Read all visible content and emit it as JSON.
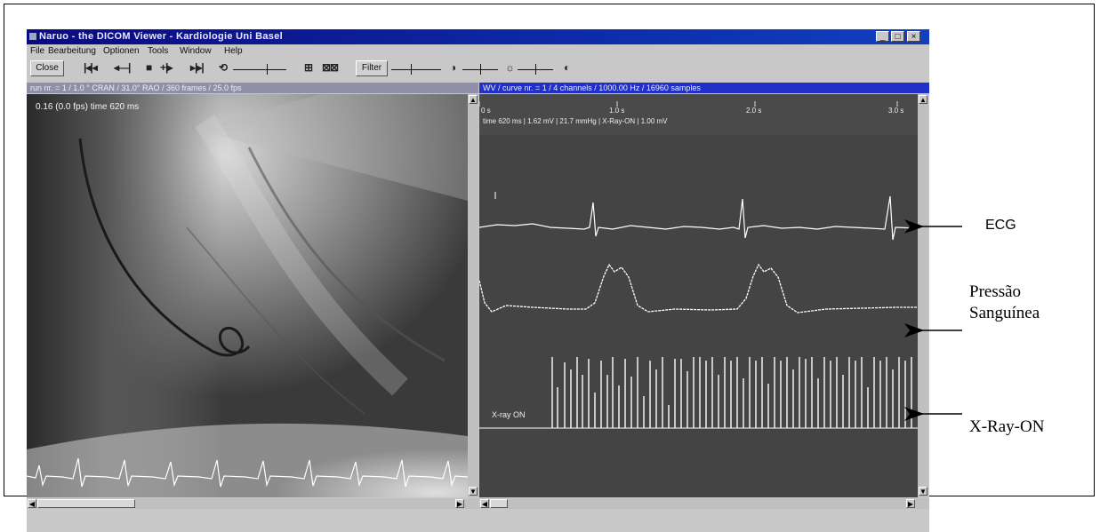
{
  "window": {
    "title": "Naruo - the DICOM Viewer - Kardiologie Uni Basel",
    "buttons": [
      "_",
      "□",
      "×"
    ]
  },
  "menu": [
    "File",
    "Bearbeitung",
    "Optionen",
    "Tools",
    "Window",
    "Help"
  ],
  "toolbar": {
    "close_label": "Close",
    "filter_label": "Filter"
  },
  "left_pane": {
    "header": "run nr. = 1 / 1.0 ° CRAN / 31.0° RAO / 360 frames / 25.0 fps",
    "overlay": "0.16 (0.0 fps) time 620 ms"
  },
  "right_pane": {
    "header": "WV / curve nr. = 1 / 4 channels / 1000.00 Hz / 16960 samples",
    "time_ticks": [
      "0 s",
      "1.0 s",
      "2.0 s",
      "3.0 s"
    ],
    "readout": "time 620 ms  |  1.62 mV  |  21.7 mmHg  |  X-Ray-ON  |  1.00 mV",
    "xray_label": "X-ray ON"
  },
  "annotations": {
    "ecg": "ECG",
    "pressure_line1": "Pressão",
    "pressure_line2": "Sanguínea",
    "xray": "X-Ray-ON"
  },
  "colors": {
    "titlebar": "#0a0a80",
    "pane_header": "#2030c8",
    "trace": "#ffffff",
    "pane_bg": "#444444"
  }
}
